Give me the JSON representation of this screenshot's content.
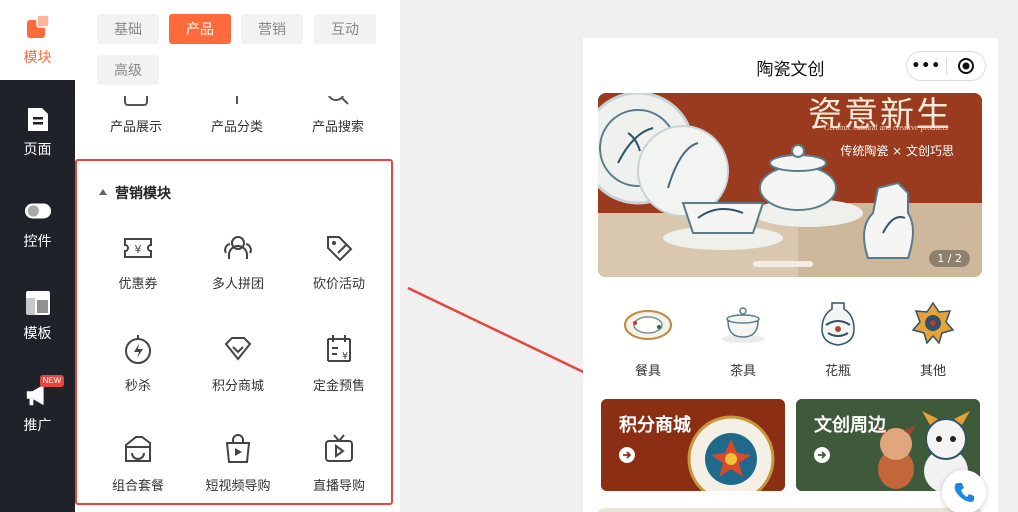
{
  "sidebar": {
    "items": [
      {
        "label": "模块",
        "icon": "modules-icon",
        "active": true
      },
      {
        "label": "页面",
        "icon": "page-icon"
      },
      {
        "label": "控件",
        "icon": "toggle-icon"
      },
      {
        "label": "模板",
        "icon": "template-icon"
      },
      {
        "label": "推广",
        "icon": "megaphone-icon",
        "badge": "NEW"
      }
    ]
  },
  "tabs": [
    "基础",
    "产品",
    "营销",
    "互动",
    "高级"
  ],
  "active_tab": "产品",
  "product_items": [
    "产品展示",
    "产品分类",
    "产品搜索"
  ],
  "marketing": {
    "title": "营销模块",
    "items": [
      {
        "label": "优惠券",
        "icon": "coupon-icon"
      },
      {
        "label": "多人拼团",
        "icon": "group-buy-icon"
      },
      {
        "label": "砍价活动",
        "icon": "bargain-icon"
      },
      {
        "label": "秒杀",
        "icon": "flash-sale-icon"
      },
      {
        "label": "积分商城",
        "icon": "points-mall-icon"
      },
      {
        "label": "定金预售",
        "icon": "presale-icon"
      },
      {
        "label": "组合套餐",
        "icon": "bundle-icon"
      },
      {
        "label": "短视频导购",
        "icon": "short-video-icon"
      },
      {
        "label": "直播导购",
        "icon": "live-tv-icon"
      }
    ]
  },
  "preview": {
    "title": "陶瓷文创",
    "capsule_dots": "•••",
    "banner": {
      "title": "瓷意新生",
      "subtitle": "Ceramic cultural and creative products",
      "tagline": "传统陶瓷 × 文创巧思",
      "page": "1 / 2"
    },
    "categories": [
      "餐具",
      "茶具",
      "花瓶",
      "其他"
    ],
    "cards": [
      {
        "title": "积分商城",
        "color": "#8b2e14"
      },
      {
        "title": "文创周边",
        "color": "#3e5a3a"
      }
    ]
  },
  "colors": {
    "accent": "#ff6a3d",
    "highlight_border": "#e8453c",
    "sidebar_bg": "#1f2229"
  }
}
